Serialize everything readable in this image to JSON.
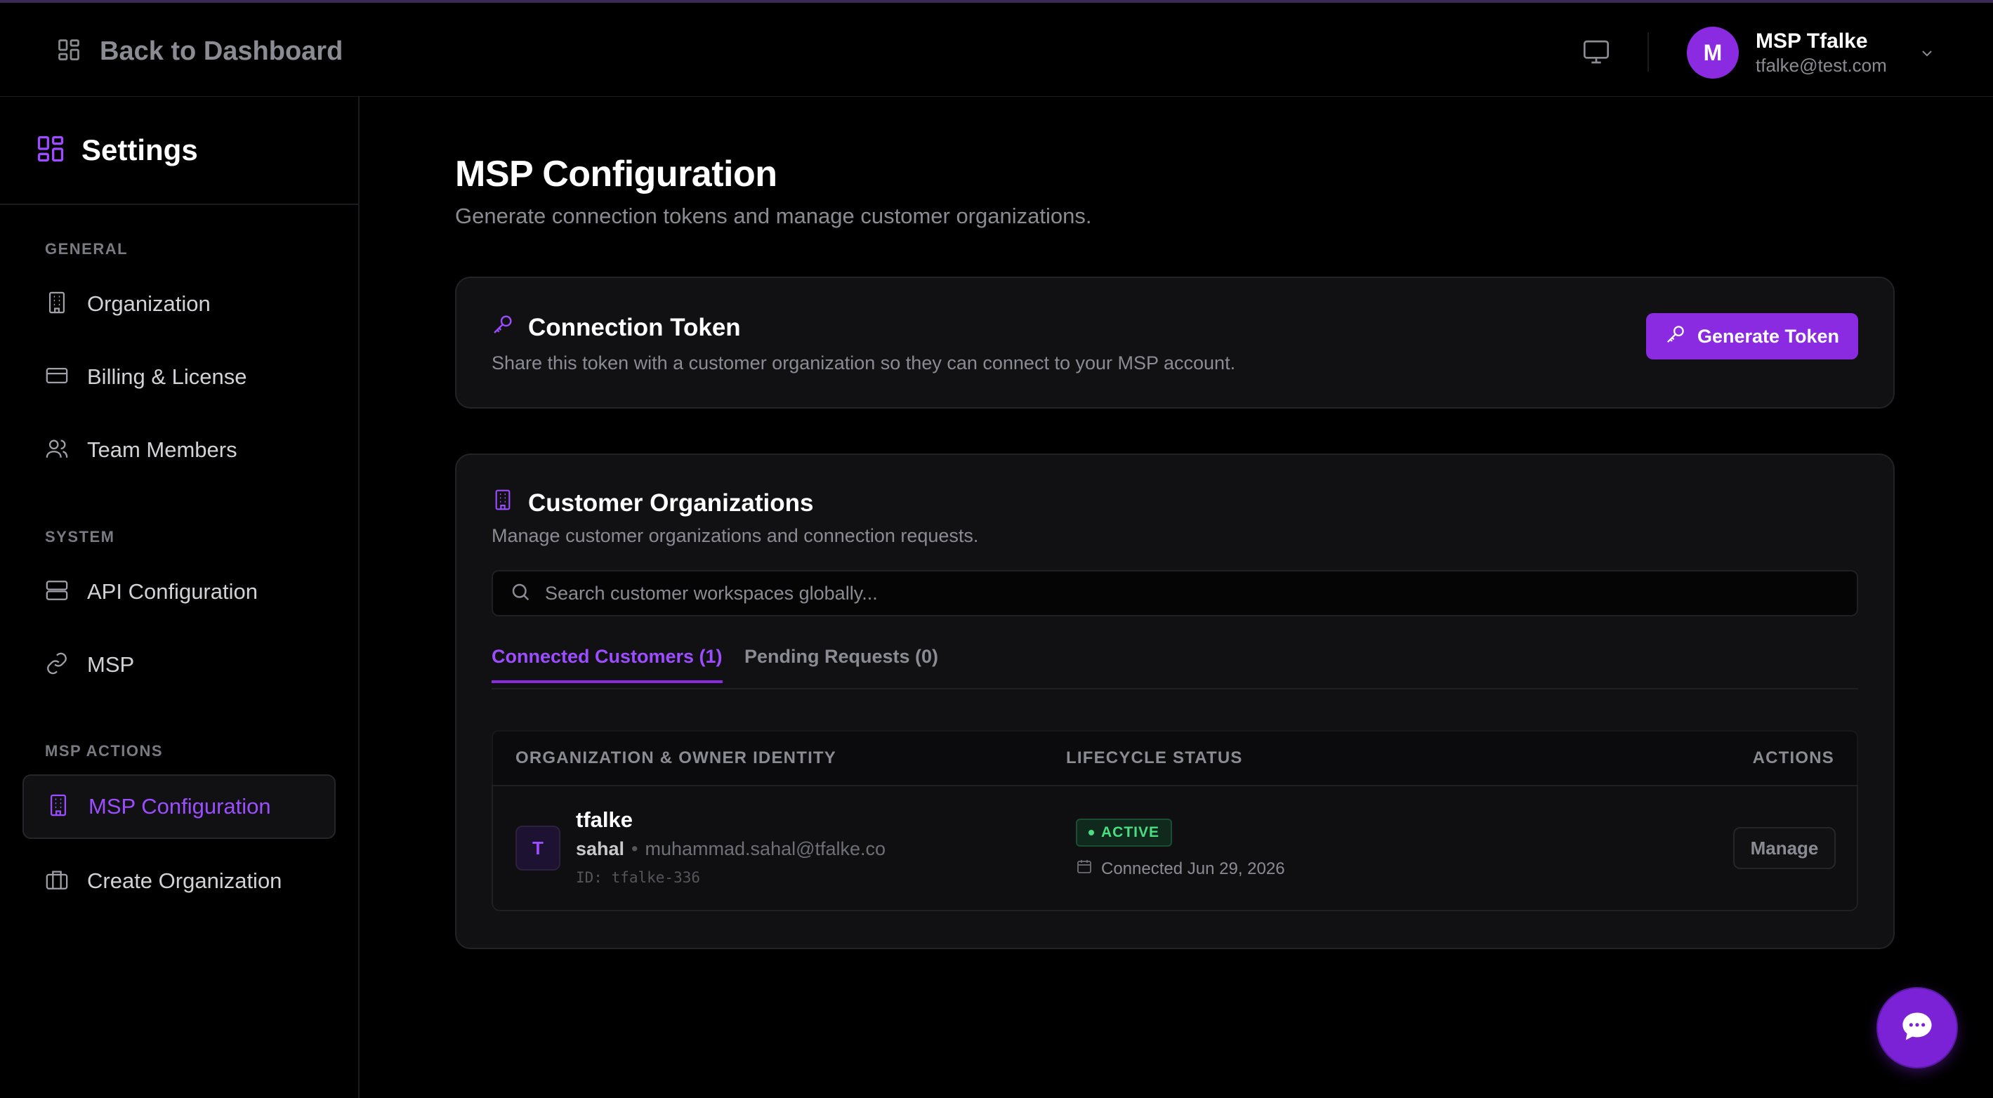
{
  "topbar": {
    "back_label": "Back to Dashboard",
    "user": {
      "initial": "M",
      "name": "MSP Tfalke",
      "email": "tfalke@test.com"
    }
  },
  "sidebar": {
    "title": "Settings",
    "sections": [
      {
        "label": "GENERAL",
        "items": [
          {
            "label": "Organization",
            "icon": "building-icon"
          },
          {
            "label": "Billing & License",
            "icon": "credit-card-icon"
          },
          {
            "label": "Team Members",
            "icon": "users-icon"
          }
        ]
      },
      {
        "label": "SYSTEM",
        "items": [
          {
            "label": "API Configuration",
            "icon": "server-icon"
          },
          {
            "label": "MSP",
            "icon": "link-icon"
          }
        ]
      },
      {
        "label": "MSP ACTIONS",
        "items": [
          {
            "label": "MSP Configuration",
            "icon": "building-icon",
            "active": true
          },
          {
            "label": "Create Organization",
            "icon": "briefcase-icon"
          }
        ]
      }
    ]
  },
  "page": {
    "title": "MSP Configuration",
    "subtitle": "Generate connection tokens and manage customer organizations."
  },
  "token_card": {
    "title": "Connection Token",
    "description": "Share this token with a customer organization so they can connect to your MSP account.",
    "button_label": "Generate Token"
  },
  "customers_card": {
    "title": "Customer Organizations",
    "description": "Manage customer organizations and connection requests.",
    "search_placeholder": "Search customer workspaces globally...",
    "tabs": [
      {
        "label": "Connected Customers (1)",
        "active": true
      },
      {
        "label": "Pending Requests (0)",
        "active": false
      }
    ],
    "columns": [
      "ORGANIZATION & OWNER IDENTITY",
      "LIFECYCLE STATUS",
      "ACTIONS"
    ],
    "rows": [
      {
        "initial": "T",
        "org_name": "tfalke",
        "owner_name": "sahal",
        "owner_email": "muhammad.sahal@tfalke.co",
        "org_id": "ID: tfalke-336",
        "status": "ACTIVE",
        "connected": "Connected Jun 29, 2026",
        "action_label": "Manage"
      }
    ]
  },
  "colors": {
    "accent": "#8a2be2",
    "accent_text": "#9b4dff",
    "background": "#000000",
    "card": "#111113",
    "status_active": "#4ade80"
  }
}
